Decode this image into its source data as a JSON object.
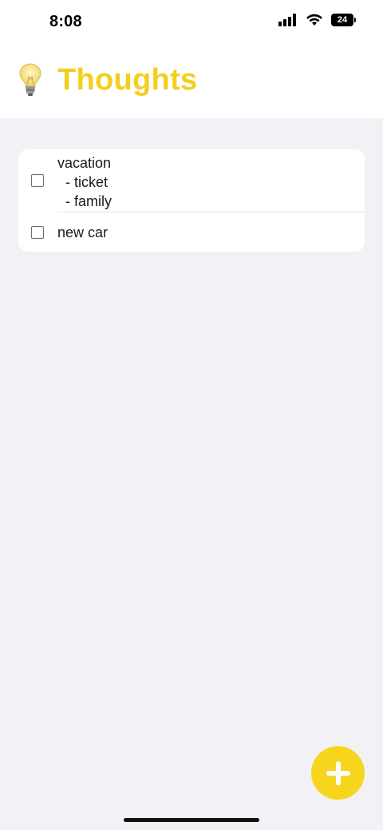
{
  "status_bar": {
    "time": "8:08",
    "battery": "24",
    "icons": [
      "signal-icon",
      "wifi-icon",
      "battery-icon"
    ]
  },
  "header": {
    "icon": "lightbulb-icon",
    "title": "Thoughts",
    "title_color": "#f3cf1d"
  },
  "items": [
    {
      "checked": false,
      "lines": [
        "vacation",
        "- ticket",
        "- family"
      ]
    },
    {
      "checked": false,
      "lines": [
        "new car"
      ]
    }
  ],
  "fab": {
    "icon": "plus-icon",
    "color": "#f7d51d"
  },
  "colors": {
    "background": "#f2f1f6",
    "card": "#ffffff"
  }
}
